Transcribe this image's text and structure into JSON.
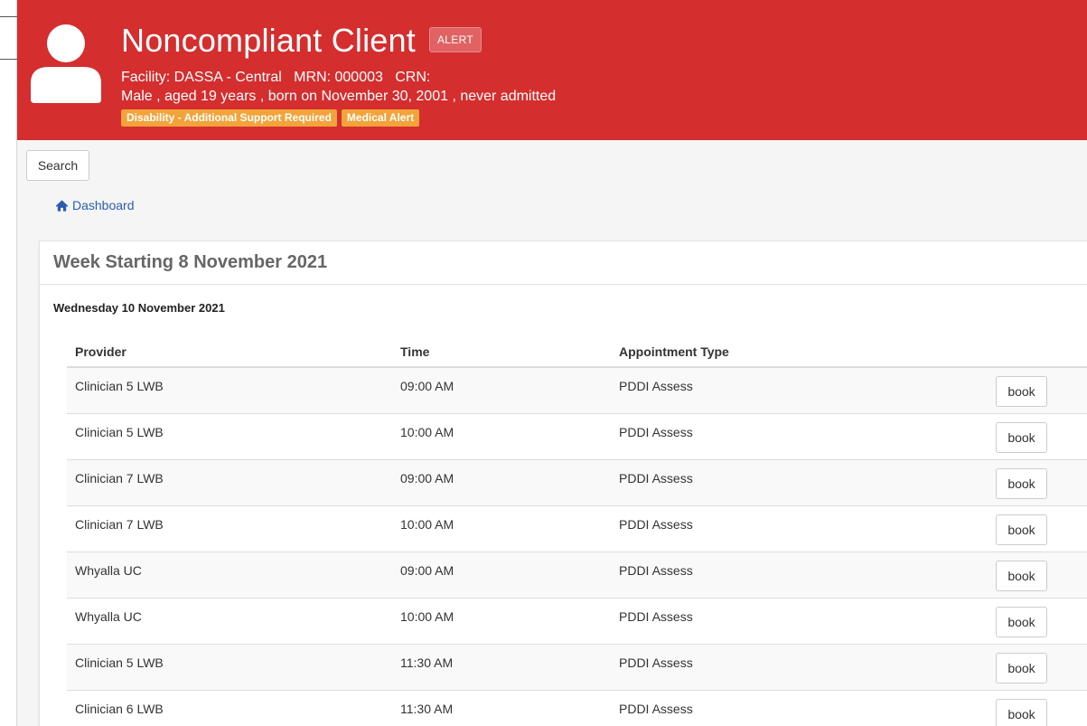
{
  "header": {
    "client_name": "Noncompliant Client",
    "alert_badge": "ALERT",
    "info_line": "Facility: DASSA - Central   MRN: 000003   CRN:",
    "demographics": "Male , aged 19 years , born on November 30, 2001 , never admitted",
    "tags": [
      "Disability - Additional Support Required",
      "Medical Alert"
    ],
    "background_color": "#d42e2e",
    "tag_color": "#f2a33a",
    "avatar_icon": "user-icon"
  },
  "toolbar": {
    "search_label": "Search"
  },
  "breadcrumb": {
    "icon": "home-icon",
    "label": "Dashboard"
  },
  "schedule": {
    "week_title": "Week Starting 8 November 2021",
    "day_title": "Wednesday 10 November 2021",
    "columns": [
      "Provider",
      "Time",
      "Appointment Type"
    ],
    "book_label": "book",
    "rows": [
      {
        "provider": "Clinician 5 LWB",
        "time": "09:00 AM",
        "type": "PDDI Assess"
      },
      {
        "provider": "Clinician 5 LWB",
        "time": "10:00 AM",
        "type": "PDDI Assess"
      },
      {
        "provider": "Clinician 7 LWB",
        "time": "09:00 AM",
        "type": "PDDI Assess"
      },
      {
        "provider": "Clinician 7 LWB",
        "time": "10:00 AM",
        "type": "PDDI Assess"
      },
      {
        "provider": "Whyalla UC",
        "time": "09:00 AM",
        "type": "PDDI Assess"
      },
      {
        "provider": "Whyalla UC",
        "time": "10:00 AM",
        "type": "PDDI Assess"
      },
      {
        "provider": "Clinician 5 LWB",
        "time": "11:30 AM",
        "type": "PDDI Assess"
      },
      {
        "provider": "Clinician 6 LWB",
        "time": "11:30 AM",
        "type": "PDDI Assess"
      }
    ]
  }
}
